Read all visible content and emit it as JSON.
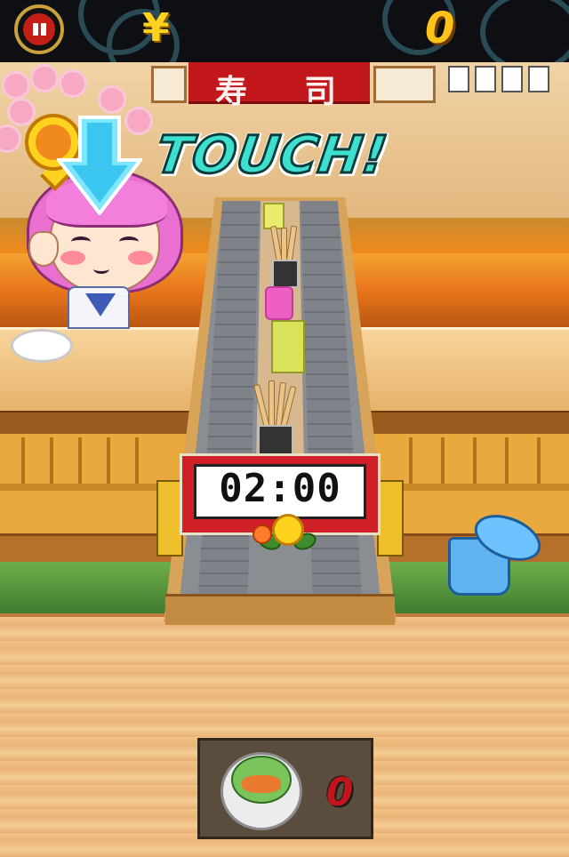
{
  "hud": {
    "currency_symbol": "¥",
    "score": "0"
  },
  "banner": {
    "kanji_left": "寿",
    "kanji_right": "司"
  },
  "hint": {
    "touch_text": "TOUCH!"
  },
  "timer": {
    "time": "02:00"
  },
  "tray": {
    "count": "0"
  },
  "colors": {
    "hud_bg": "#0d0f12",
    "pause_red": "#c41f16",
    "score_gold": "#ffc21a",
    "touch_cyan": "#3de0cf",
    "timer_red": "#cf2027",
    "hair_pink": "#e96fd0"
  },
  "icons": [
    "pause-icon",
    "yen-icon",
    "down-arrow-icon",
    "coin-marker-icon",
    "flower-icon"
  ]
}
